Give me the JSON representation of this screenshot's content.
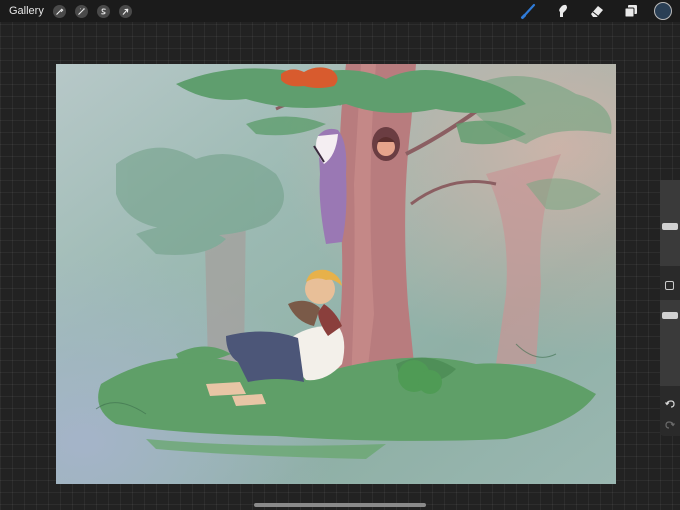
{
  "topbar": {
    "gallery_label": "Gallery",
    "left_tools": [
      {
        "name": "actions",
        "icon": "wrench-icon"
      },
      {
        "name": "adjustments",
        "icon": "magic-wand-icon"
      },
      {
        "name": "selection",
        "icon": "selection-s-icon"
      },
      {
        "name": "transform",
        "icon": "arrow-cursor-icon"
      }
    ],
    "right_tools": [
      {
        "name": "brush",
        "icon": "brush-icon",
        "active": true
      },
      {
        "name": "smudge",
        "icon": "smudge-icon"
      },
      {
        "name": "eraser",
        "icon": "eraser-icon"
      },
      {
        "name": "layers",
        "icon": "layers-icon"
      }
    ],
    "current_color": "#2a3f55",
    "active_color": "#2f7bd8"
  },
  "sidebar": {
    "brush_size_level": 0.45,
    "opacity_level": 0.15
  }
}
